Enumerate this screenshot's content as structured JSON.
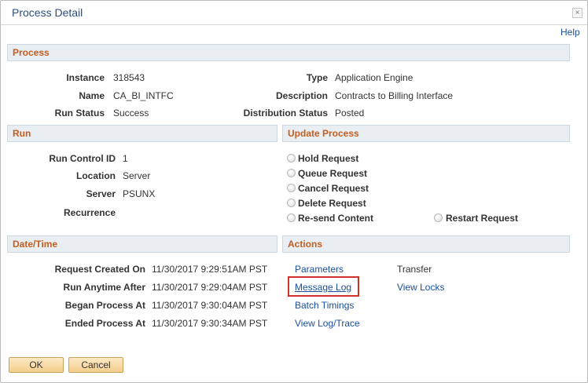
{
  "window": {
    "title": "Process Detail",
    "help_link": "Help"
  },
  "process": {
    "header": "Process",
    "instance_label": "Instance",
    "instance_value": "318543",
    "name_label": "Name",
    "name_value": "CA_BI_INTFC",
    "run_status_label": "Run Status",
    "run_status_value": "Success",
    "type_label": "Type",
    "type_value": "Application Engine",
    "description_label": "Description",
    "description_value": "Contracts to Billing Interface",
    "distribution_status_label": "Distribution Status",
    "distribution_status_value": "Posted"
  },
  "run": {
    "header": "Run",
    "run_control_id_label": "Run Control ID",
    "run_control_id_value": "1",
    "location_label": "Location",
    "location_value": "Server",
    "server_label": "Server",
    "server_value": "PSUNX",
    "recurrence_label": "Recurrence"
  },
  "update_process": {
    "header": "Update Process",
    "options": [
      "Hold Request",
      "Queue Request",
      "Cancel Request",
      "Delete Request",
      "Re-send Content",
      "Restart Request"
    ]
  },
  "datetime": {
    "header": "Date/Time",
    "rows": [
      {
        "label": "Request Created On",
        "value": "11/30/2017  9:29:51AM PST"
      },
      {
        "label": "Run Anytime After",
        "value": "11/30/2017  9:29:04AM PST"
      },
      {
        "label": "Began Process At",
        "value": "11/30/2017  9:30:04AM PST"
      },
      {
        "label": "Ended Process At",
        "value": "11/30/2017  9:30:34AM PST"
      }
    ]
  },
  "actions": {
    "header": "Actions",
    "parameters": "Parameters",
    "message_log": "Message Log",
    "batch_timings": "Batch Timings",
    "view_log_trace": "View Log/Trace",
    "transfer": "Transfer",
    "view_locks": "View Locks"
  },
  "buttons": {
    "ok": "OK",
    "cancel": "Cancel"
  },
  "colors": {
    "section_header_text": "#c45d1f",
    "link": "#1a4e9c",
    "highlight": "#d0312d",
    "button_fill": "#f4cf8c"
  }
}
